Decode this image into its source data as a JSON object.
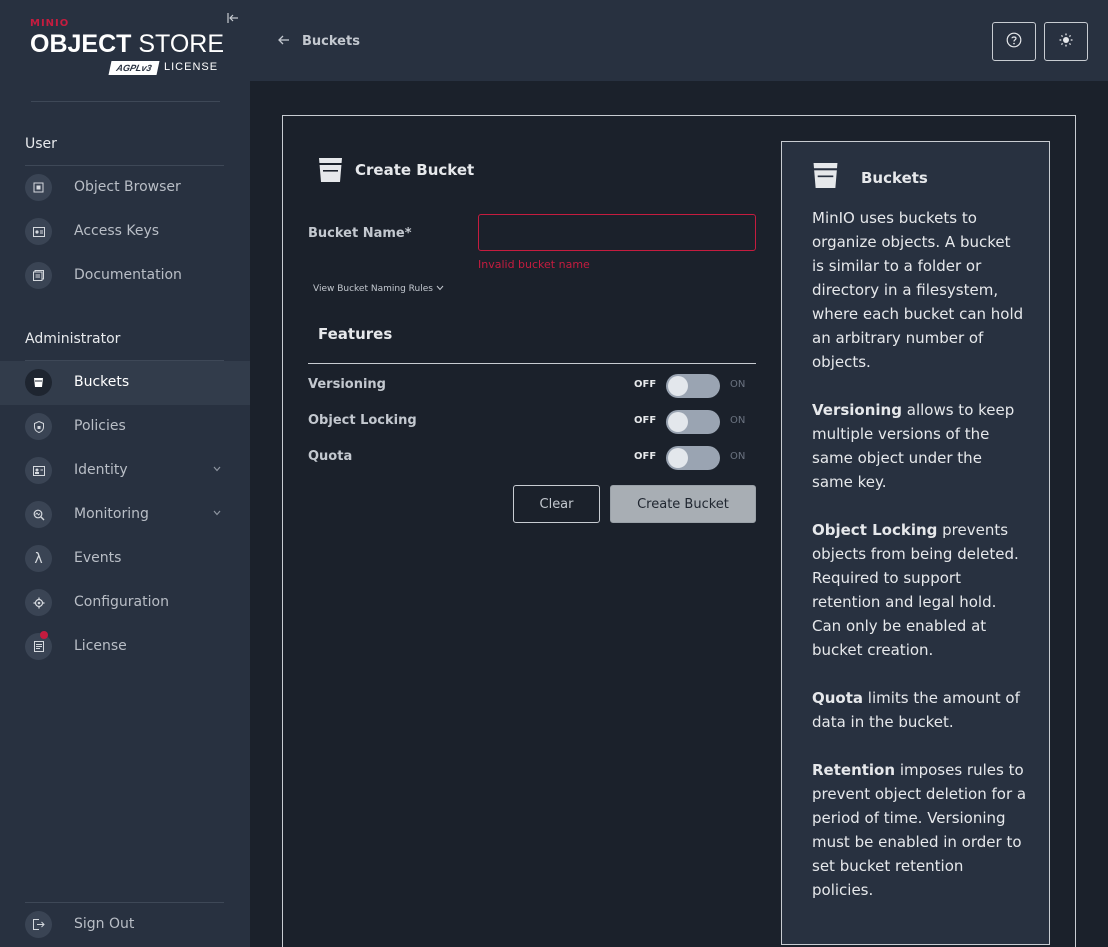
{
  "brand": {
    "top": "MINIO",
    "product_bold": "OBJECT",
    "product_light": " STORE",
    "badge": "AGPLv3",
    "license_text": "LICENSE"
  },
  "sidebar": {
    "user_section": "User",
    "admin_section": "Administrator",
    "user_items": [
      {
        "label": "Object Browser",
        "icon": "object-browser-icon"
      },
      {
        "label": "Access Keys",
        "icon": "access-keys-icon"
      },
      {
        "label": "Documentation",
        "icon": "documentation-icon"
      }
    ],
    "admin_items": [
      {
        "label": "Buckets",
        "icon": "bucket-icon",
        "active": true
      },
      {
        "label": "Policies",
        "icon": "policies-icon"
      },
      {
        "label": "Identity",
        "icon": "identity-icon",
        "expandable": true
      },
      {
        "label": "Monitoring",
        "icon": "monitoring-icon",
        "expandable": true
      },
      {
        "label": "Events",
        "icon": "lambda-icon"
      },
      {
        "label": "Configuration",
        "icon": "gear-icon"
      },
      {
        "label": "License",
        "icon": "license-icon",
        "notification": true
      }
    ],
    "sign_out": "Sign Out"
  },
  "header": {
    "back_label": "Buckets",
    "help_icon": "help-icon",
    "theme_icon": "sun-icon"
  },
  "form": {
    "title": "Create Bucket",
    "bucket_name_label": "Bucket Name*",
    "bucket_name_value": "",
    "bucket_name_error": "Invalid bucket name",
    "rules_link": "View Bucket Naming Rules",
    "features_title": "Features",
    "features": [
      {
        "label": "Versioning",
        "off": "OFF",
        "on": "ON",
        "enabled": false
      },
      {
        "label": "Object Locking",
        "off": "OFF",
        "on": "ON",
        "enabled": false
      },
      {
        "label": "Quota",
        "off": "OFF",
        "on": "ON",
        "enabled": false
      }
    ],
    "clear_label": "Clear",
    "create_label": "Create Bucket"
  },
  "help": {
    "title": "Buckets",
    "intro": "MinIO uses buckets to organize objects. A bucket is similar to a folder or directory in a filesystem, where each bucket can hold an arbitrary number of objects.",
    "versioning_term": "Versioning",
    "versioning_text": " allows to keep multiple versions of the same object under the same key.",
    "locking_term": "Object Locking",
    "locking_text": " prevents objects from being deleted. Required to support retention and legal hold. Can only be enabled at bucket creation.",
    "quota_term": "Quota",
    "quota_text": " limits the amount of data in the bucket.",
    "retention_term": "Retention",
    "retention_text": " imposes rules to prevent object deletion for a period of time. Versioning must be enabled in order to set bucket retention policies."
  },
  "colors": {
    "accent": "#c51c3f",
    "sidebar_bg": "#283140",
    "page_bg": "#1b212b"
  }
}
